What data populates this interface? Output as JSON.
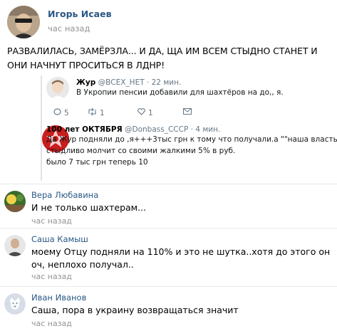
{
  "post": {
    "author": "Игорь Исаев",
    "time": "час назад",
    "text": "РАЗВАЛИЛАСЬ, ЗАМЁРЗЛА... И ДА, ЩА ИМ ВСЕМ СТЫДНО СТАНЕТ И ОНИ НАЧНУТ ПРОСИТЬСЯ В ЛДНР!"
  },
  "tweet1": {
    "name": "Жур",
    "handle": "@ВСЕХ_НЕТ · 22 мин.",
    "text": "В Укропии пенсии добавили для шахтёров на до,, я.",
    "replies": "5",
    "retweets": "1",
    "likes": "1"
  },
  "tweet2": {
    "name": "100 лет ОКТЯБРЯ",
    "handle": "@Donbass_CCCP · 4 мин.",
    "line1": "Да Жур подняли до ,я+++3тыс грн к тому что получали.а \"\"наша власть\"",
    "line2": "стыдливо молчит со своими жалкими 5% в руб.",
    "line3": "было 7 тыс грн теперь 10"
  },
  "comments": [
    {
      "author": "Вера Любавина",
      "text": "И не только шахтерам...",
      "time": "час назад"
    },
    {
      "author": "Саша Камыш",
      "text": "моему Отцу подняли на 110% и это не шутка..хотя до этого он оч, неплохо получал..",
      "time": "час назад"
    },
    {
      "author": "Иван Иванов",
      "text": "Саша, пора в украину возвращаться значит",
      "time": "час назад"
    }
  ]
}
